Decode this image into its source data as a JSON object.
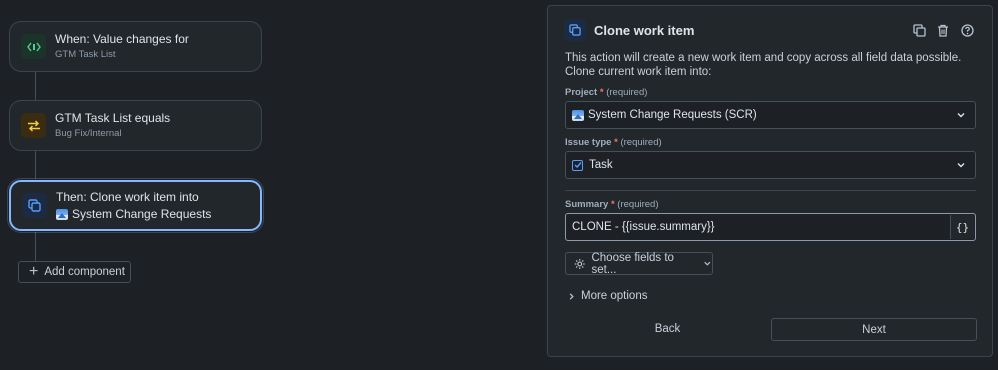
{
  "flow": {
    "trigger": {
      "title": "When: Value changes for",
      "subtitle": "GTM Task List"
    },
    "condition": {
      "title": "GTM Task List equals",
      "subtitle": "Bug Fix/Internal"
    },
    "action": {
      "title": "Then: Clone work item into",
      "subtitle": "System Change Requests"
    },
    "add_component_label": "Add component"
  },
  "panel": {
    "title": "Clone work item",
    "description": "This action will create a new work item and copy across all field data possible. Clone current work item into:",
    "project": {
      "label": "Project",
      "required_mark": "*",
      "required_text": "(required)",
      "value": "System Change Requests (SCR)"
    },
    "issue_type": {
      "label": "Issue type",
      "required_mark": "*",
      "required_text": "(required)",
      "value": "Task"
    },
    "summary": {
      "label": "Summary",
      "required_mark": "*",
      "required_text": "(required)",
      "value": "CLONE - {{issue.summary}}",
      "smart_value_button": "{}"
    },
    "choose_fields_label": "Choose fields to set...",
    "more_options_label": "More options",
    "back_label": "Back",
    "next_label": "Next"
  },
  "colors": {
    "background": "#1d2125",
    "panel": "#22272b",
    "selected_outline": "#85b8ff",
    "required": "#f87168",
    "trigger_icon": "#4bce97",
    "condition_icon": "#f5cd47",
    "action_icon": "#579dff"
  },
  "icons": {
    "trigger": "value-change-icon",
    "condition": "branch-swap-icon",
    "action": "clone-icon",
    "header_actions": [
      "duplicate-icon",
      "trash-icon",
      "help-icon"
    ]
  }
}
